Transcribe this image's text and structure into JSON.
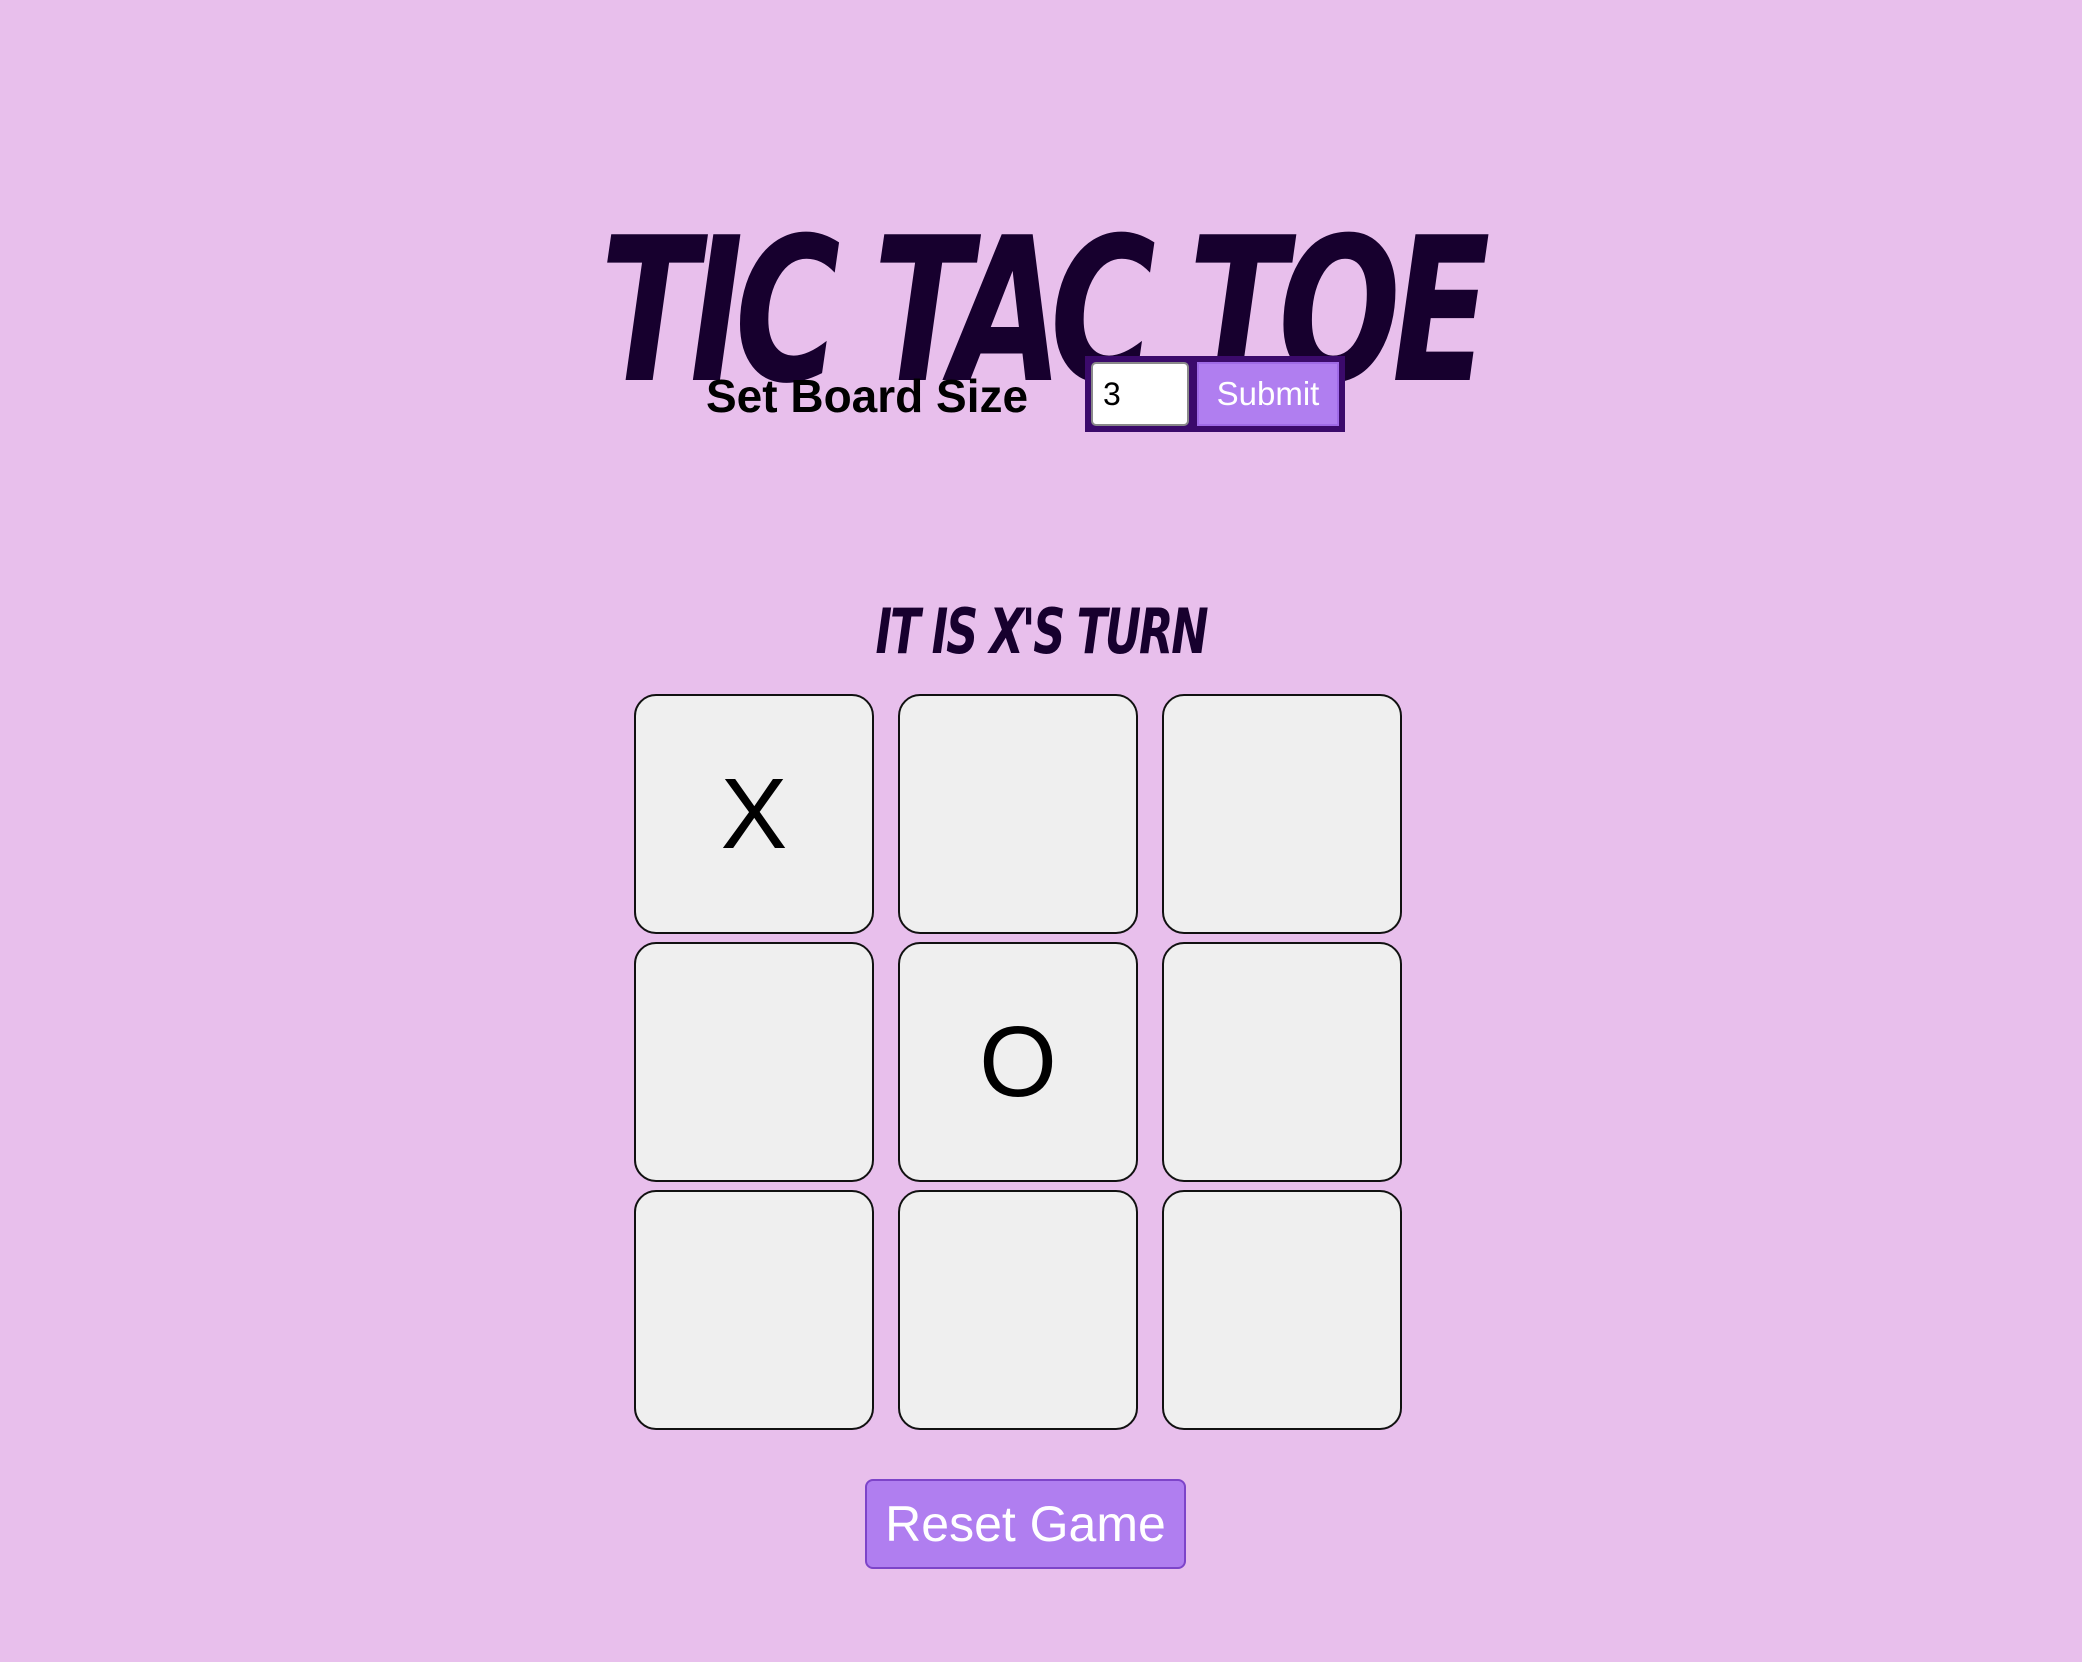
{
  "header": {
    "title": "Tic Tac Toe"
  },
  "board_size": {
    "label": "Set Board Size",
    "value": "3",
    "submit_label": "Submit"
  },
  "status": {
    "text": "It is X's turn"
  },
  "board": {
    "size": 3,
    "cells": [
      "X",
      "",
      "",
      "",
      "O",
      "",
      "",
      "",
      ""
    ]
  },
  "controls": {
    "reset_label": "Reset Game"
  },
  "colors": {
    "background": "#e8bfec",
    "title": "#17002e",
    "button": "#b07ef0",
    "form_frame": "#3b0a6b",
    "cell": "#efefef"
  }
}
